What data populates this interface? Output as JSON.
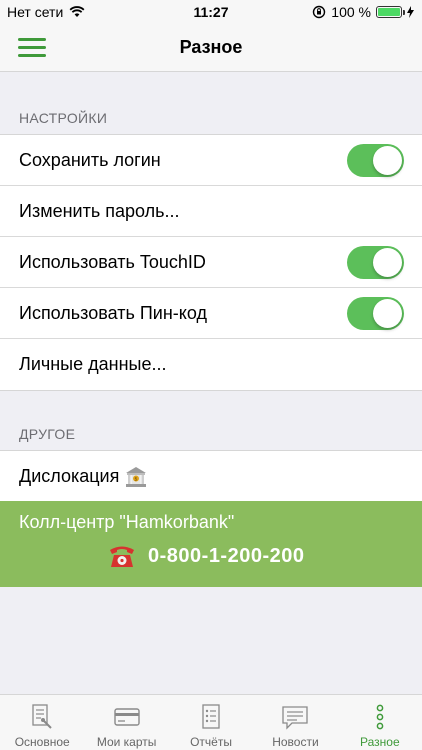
{
  "status_bar": {
    "carrier": "Нет сети",
    "time": "11:27",
    "battery_percent": "100 %",
    "battery_level": 1.0
  },
  "nav": {
    "title": "Разное"
  },
  "settings": {
    "header": "НАСТРОЙКИ",
    "items": [
      {
        "label": "Сохранить логин",
        "toggle": true
      },
      {
        "label": "Изменить пароль..."
      },
      {
        "label": "Использовать TouchID",
        "toggle": true
      },
      {
        "label": "Использовать Пин-код",
        "toggle": true
      },
      {
        "label": "Личные данные..."
      }
    ]
  },
  "other": {
    "header": "ДРУГОЕ",
    "items": [
      {
        "label": "Дислокация",
        "icon": "bank-icon"
      }
    ]
  },
  "call_center": {
    "title": "Колл-центр \"Hamkorbank\"",
    "phone": "0-800-1-200-200",
    "icon": "telephone-icon",
    "background": "#8bbc5d"
  },
  "tabs": [
    {
      "label": "Основное",
      "icon": "document-icon"
    },
    {
      "label": "Мои карты",
      "icon": "card-icon"
    },
    {
      "label": "Отчёты",
      "icon": "report-icon"
    },
    {
      "label": "Новости",
      "icon": "news-icon"
    },
    {
      "label": "Разное",
      "icon": "more-dots-icon",
      "active": true
    }
  ],
  "colors": {
    "accent": "#3f9a3a",
    "toggle_on": "#5cbf5a"
  }
}
